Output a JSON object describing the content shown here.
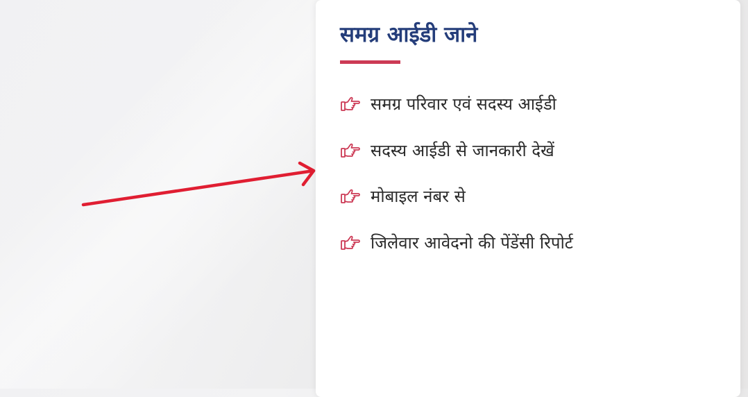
{
  "colors": {
    "title": "#243d7a",
    "accent": "#cc3a55",
    "link_text": "#2a2a2a",
    "arrow": "#e01e32",
    "card_bg": "#ffffff"
  },
  "panel": {
    "title": "समग्र आईडी जाने",
    "items": [
      {
        "label": "समग्र परिवार एवं सदस्य आईडी",
        "icon": "hand-pointing-right-icon"
      },
      {
        "label": "सदस्य आईडी से जानकारी देखें",
        "icon": "hand-pointing-right-icon"
      },
      {
        "label": "मोबाइल नंबर से",
        "icon": "hand-pointing-right-icon"
      },
      {
        "label": "जिलेवार आवेदनो की पेंडेंसी रिपोर्ट",
        "icon": "hand-pointing-right-icon"
      }
    ]
  },
  "annotation": {
    "icon": "red-arrow-icon"
  }
}
